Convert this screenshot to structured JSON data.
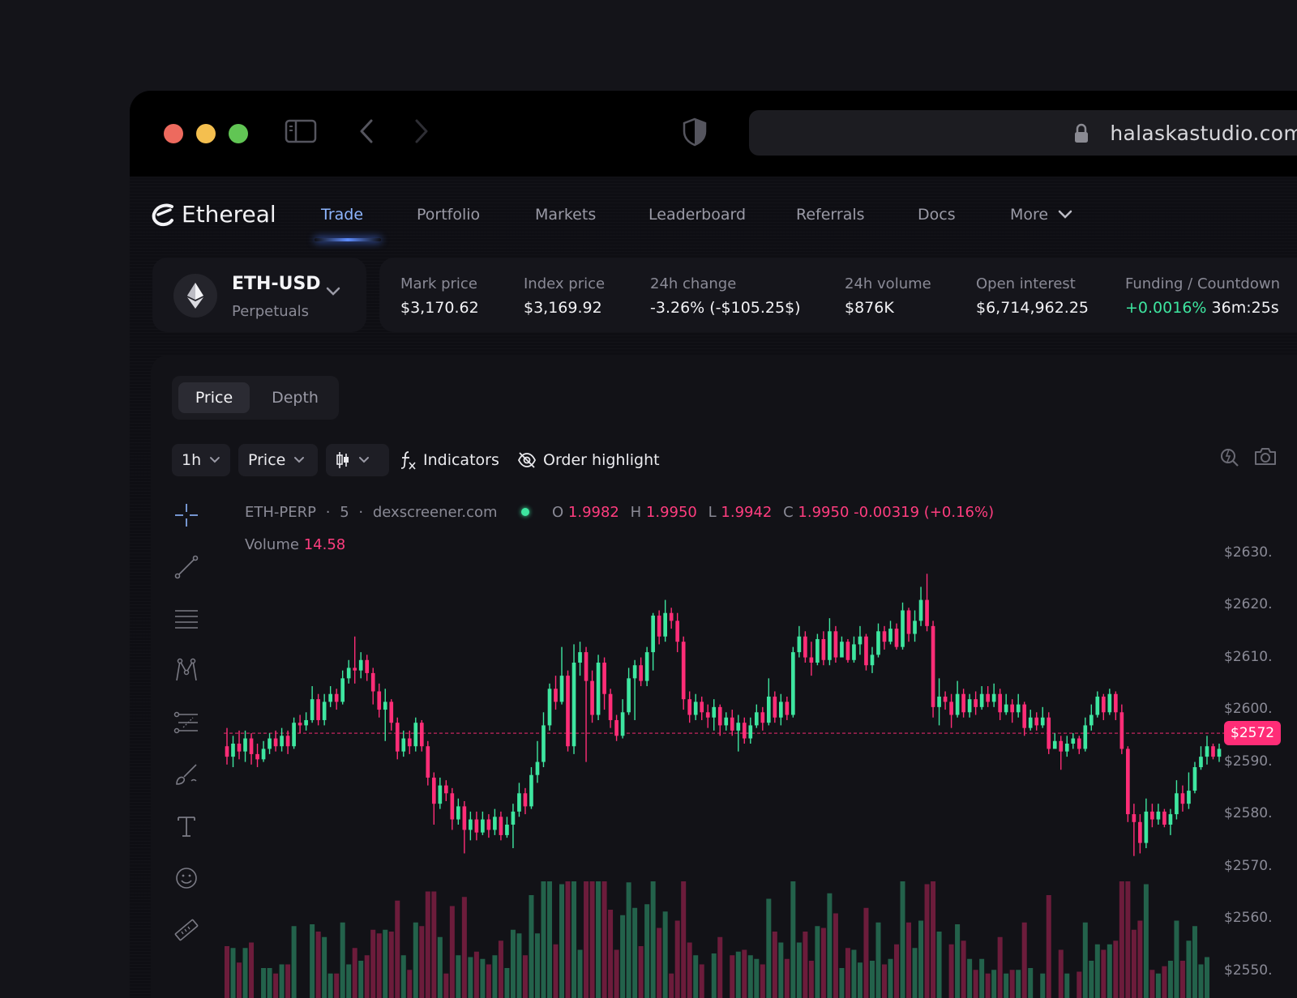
{
  "browser": {
    "url": "halaskastudio.com"
  },
  "app": {
    "logo_text": "Ethereal"
  },
  "nav": {
    "items": [
      {
        "label": "Trade",
        "active": true
      },
      {
        "label": "Portfolio"
      },
      {
        "label": "Markets"
      },
      {
        "label": "Leaderboard"
      },
      {
        "label": "Referrals"
      },
      {
        "label": "Docs"
      },
      {
        "label": "More"
      }
    ]
  },
  "pair": {
    "name": "ETH-USD",
    "type": "Perpetuals"
  },
  "stats": {
    "mark": {
      "label": "Mark price",
      "value": "$3,170.62"
    },
    "index": {
      "label": "Index price",
      "value": "$3,169.92"
    },
    "change": {
      "label": "24h change",
      "value": "-3.26% (-$105.25$)"
    },
    "volume": {
      "label": "24h volume",
      "value": "$876K"
    },
    "oi": {
      "label": "Open interest",
      "value": "$6,714,962.25"
    },
    "funding": {
      "label": "Funding / Countdown",
      "rate": "+0.0016%",
      "countdown": "36m:25s"
    }
  },
  "tabs": {
    "price": "Price",
    "depth": "Depth"
  },
  "toolbar": {
    "interval": "1h",
    "mode": "Price",
    "indicators": "Indicators",
    "order_highlight": "Order highlight"
  },
  "legend": {
    "symbol": "ETH-PERP",
    "interval": "5",
    "source": "dexscreener.com",
    "o_label": "O",
    "o": "1.9982",
    "h_label": "H",
    "h": "1.9950",
    "l_label": "L",
    "l": "1.9942",
    "c_label": "C",
    "c": "1.9950",
    "change": "-0.00319 (+0.16%)",
    "volume_label": "Volume",
    "volume": "14.58"
  },
  "colors": {
    "up": "#3ee6a0",
    "down": "#ff2d77",
    "accent": "#8eb6ff"
  },
  "chart_data": {
    "type": "candlestick",
    "y_ticks": [
      "$2630.",
      "$2620.",
      "$2610.",
      "$2600.",
      "$2572",
      "$2590.",
      "$2580.",
      "$2570.",
      "$2560.",
      "$2550."
    ],
    "y_tick_values": [
      2630,
      2620,
      2610,
      2600,
      2590,
      2580,
      2570,
      2560,
      2550
    ],
    "ylim": [
      2547,
      2640
    ],
    "current_price_label": "$2572",
    "current_price": 2595.5,
    "candles": [
      [
        2593.0,
        2591.0,
        2596.5,
        2589.5
      ],
      [
        2591.0,
        2593.5,
        2595.0,
        2589.0
      ],
      [
        2593.5,
        2592.0,
        2596.0,
        2590.5
      ],
      [
        2592.0,
        2594.5,
        2596.0,
        2590.0
      ],
      [
        2594.5,
        2591.5,
        2595.5,
        2589.5
      ],
      [
        2591.5,
        2590.5,
        2593.5,
        2589.0
      ],
      [
        2590.5,
        2592.5,
        2594.0,
        2590.0
      ],
      [
        2592.5,
        2594.5,
        2595.5,
        2591.5
      ],
      [
        2594.5,
        2593.0,
        2596.0,
        2592.0
      ],
      [
        2593.0,
        2595.0,
        2596.5,
        2592.0
      ],
      [
        2595.0,
        2593.0,
        2596.0,
        2591.5
      ],
      [
        2593.0,
        2597.5,
        2598.5,
        2592.5
      ],
      [
        2597.5,
        2597.0,
        2599.0,
        2595.5
      ],
      [
        2597.0,
        2598.0,
        2599.5,
        2596.0
      ],
      [
        2598.0,
        2602.0,
        2604.5,
        2597.5
      ],
      [
        2602.0,
        2598.0,
        2603.0,
        2597.0
      ],
      [
        2598.0,
        2601.5,
        2603.0,
        2597.0
      ],
      [
        2601.5,
        2603.0,
        2604.5,
        2600.5
      ],
      [
        2603.0,
        2601.5,
        2604.0,
        2600.0
      ],
      [
        2601.5,
        2606.0,
        2607.5,
        2601.0
      ],
      [
        2606.0,
        2608.0,
        2609.5,
        2605.0
      ],
      [
        2608.0,
        2607.5,
        2614.0,
        2605.0
      ],
      [
        2607.5,
        2609.5,
        2611.0,
        2606.0
      ],
      [
        2609.5,
        2607.0,
        2610.5,
        2605.5
      ],
      [
        2607.0,
        2603.5,
        2608.0,
        2601.0
      ],
      [
        2603.5,
        2600.0,
        2605.0,
        2598.5
      ],
      [
        2600.0,
        2601.5,
        2604.0,
        2594.0
      ],
      [
        2601.5,
        2597.5,
        2602.0,
        2596.0
      ],
      [
        2597.5,
        2592.0,
        2598.5,
        2590.5
      ],
      [
        2592.0,
        2594.5,
        2596.0,
        2591.0
      ],
      [
        2594.5,
        2593.0,
        2596.0,
        2591.5
      ],
      [
        2593.0,
        2597.5,
        2598.5,
        2592.0
      ],
      [
        2597.5,
        2593.0,
        2598.0,
        2592.0
      ],
      [
        2593.0,
        2587.0,
        2594.0,
        2585.5
      ],
      [
        2587.0,
        2582.0,
        2588.0,
        2578.0
      ],
      [
        2582.0,
        2585.5,
        2587.0,
        2581.0
      ],
      [
        2585.5,
        2584.0,
        2586.5,
        2582.5
      ],
      [
        2584.0,
        2579.0,
        2585.0,
        2577.0
      ],
      [
        2579.0,
        2581.5,
        2583.0,
        2578.0
      ],
      [
        2581.5,
        2577.0,
        2582.5,
        2572.5
      ],
      [
        2577.0,
        2579.0,
        2580.5,
        2575.0
      ],
      [
        2579.0,
        2576.5,
        2580.5,
        2575.0
      ],
      [
        2576.5,
        2579.0,
        2580.5,
        2576.0
      ],
      [
        2579.0,
        2577.0,
        2580.0,
        2575.5
      ],
      [
        2577.0,
        2579.5,
        2581.0,
        2576.0
      ],
      [
        2579.5,
        2576.0,
        2580.5,
        2575.0
      ],
      [
        2576.0,
        2578.0,
        2579.5,
        2575.5
      ],
      [
        2578.0,
        2580.5,
        2582.0,
        2573.5
      ],
      [
        2580.5,
        2584.0,
        2586.0,
        2579.5
      ],
      [
        2584.0,
        2581.5,
        2585.0,
        2580.0
      ],
      [
        2581.5,
        2587.5,
        2589.0,
        2581.0
      ],
      [
        2587.5,
        2590.0,
        2594.0,
        2586.0
      ],
      [
        2590.0,
        2597.0,
        2599.5,
        2589.0
      ],
      [
        2597.0,
        2604.0,
        2605.0,
        2596.0
      ],
      [
        2604.0,
        2601.5,
        2606.5,
        2600.0
      ],
      [
        2601.5,
        2606.5,
        2612.0,
        2601.0
      ],
      [
        2606.5,
        2593.0,
        2607.5,
        2592.0
      ],
      [
        2593.0,
        2609.0,
        2612.5,
        2591.5
      ],
      [
        2609.0,
        2611.0,
        2613.0,
        2606.5
      ],
      [
        2611.0,
        2605.5,
        2612.0,
        2590.0
      ],
      [
        2605.5,
        2599.0,
        2607.5,
        2597.5
      ],
      [
        2599.0,
        2609.0,
        2610.5,
        2598.0
      ],
      [
        2609.0,
        2603.0,
        2610.0,
        2600.0
      ],
      [
        2603.0,
        2598.0,
        2604.0,
        2596.5
      ],
      [
        2598.0,
        2595.0,
        2599.0,
        2594.0
      ],
      [
        2595.0,
        2599.5,
        2602.0,
        2594.5
      ],
      [
        2599.5,
        2606.0,
        2608.0,
        2599.0
      ],
      [
        2606.0,
        2608.5,
        2609.5,
        2598.0
      ],
      [
        2608.5,
        2605.5,
        2610.0,
        2604.5
      ],
      [
        2605.5,
        2611.0,
        2612.0,
        2604.5
      ],
      [
        2611.0,
        2618.0,
        2618.5,
        2607.5
      ],
      [
        2618.0,
        2614.0,
        2619.0,
        2612.5
      ],
      [
        2614.0,
        2618.5,
        2621.0,
        2613.0
      ],
      [
        2618.5,
        2617.0,
        2619.5,
        2615.5
      ],
      [
        2617.0,
        2613.0,
        2618.5,
        2611.0
      ],
      [
        2613.0,
        2602.0,
        2614.0,
        2600.0
      ],
      [
        2602.0,
        2599.0,
        2603.5,
        2597.5
      ],
      [
        2599.0,
        2601.5,
        2603.0,
        2598.0
      ],
      [
        2601.5,
        2599.5,
        2602.5,
        2598.0
      ],
      [
        2599.5,
        2598.5,
        2601.0,
        2596.5
      ],
      [
        2598.5,
        2600.5,
        2602.0,
        2596.0
      ],
      [
        2600.5,
        2597.0,
        2601.0,
        2595.0
      ],
      [
        2597.0,
        2598.5,
        2599.5,
        2596.0
      ],
      [
        2598.5,
        2596.0,
        2600.0,
        2595.0
      ],
      [
        2596.0,
        2597.5,
        2599.0,
        2592.0
      ],
      [
        2597.5,
        2594.5,
        2598.5,
        2593.5
      ],
      [
        2594.5,
        2597.0,
        2598.5,
        2593.5
      ],
      [
        2597.0,
        2599.5,
        2601.0,
        2596.5
      ],
      [
        2599.5,
        2597.5,
        2600.5,
        2596.0
      ],
      [
        2597.5,
        2602.5,
        2606.0,
        2597.0
      ],
      [
        2602.5,
        2598.5,
        2603.5,
        2597.5
      ],
      [
        2598.5,
        2601.5,
        2603.0,
        2597.0
      ],
      [
        2601.5,
        2599.0,
        2602.5,
        2598.0
      ],
      [
        2599.0,
        2611.0,
        2612.0,
        2598.5
      ],
      [
        2611.0,
        2614.0,
        2616.0,
        2610.0
      ],
      [
        2614.0,
        2610.0,
        2615.0,
        2609.0
      ],
      [
        2610.0,
        2609.0,
        2613.0,
        2606.5
      ],
      [
        2609.0,
        2613.5,
        2614.5,
        2608.5
      ],
      [
        2613.5,
        2609.5,
        2615.0,
        2608.5
      ],
      [
        2609.5,
        2615.0,
        2617.5,
        2608.5
      ],
      [
        2615.0,
        2610.0,
        2616.0,
        2609.0
      ],
      [
        2610.0,
        2613.0,
        2614.0,
        2611.5
      ],
      [
        2613.0,
        2609.5,
        2613.5,
        2609.0
      ],
      [
        2609.5,
        2612.5,
        2614.0,
        2609.0
      ],
      [
        2612.5,
        2614.0,
        2616.0,
        2610.5
      ],
      [
        2614.0,
        2608.5,
        2614.5,
        2607.5
      ],
      [
        2608.5,
        2610.5,
        2612.0,
        2607.0
      ],
      [
        2610.5,
        2615.0,
        2616.5,
        2610.0
      ],
      [
        2615.0,
        2613.0,
        2616.0,
        2611.5
      ],
      [
        2613.0,
        2615.5,
        2617.0,
        2612.5
      ],
      [
        2615.5,
        2612.0,
        2616.5,
        2611.5
      ],
      [
        2612.0,
        2619.0,
        2620.5,
        2611.5
      ],
      [
        2619.0,
        2614.5,
        2619.5,
        2613.0
      ],
      [
        2614.5,
        2617.0,
        2619.0,
        2613.0
      ],
      [
        2617.0,
        2621.0,
        2623.5,
        2616.0
      ],
      [
        2621.0,
        2616.0,
        2626.0,
        2615.0
      ],
      [
        2616.0,
        2600.5,
        2617.0,
        2598.5
      ],
      [
        2600.5,
        2602.5,
        2606.0,
        2597.0
      ],
      [
        2602.5,
        2601.5,
        2603.5,
        2600.0
      ],
      [
        2601.5,
        2599.0,
        2603.0,
        2596.5
      ],
      [
        2599.0,
        2603.0,
        2605.5,
        2598.5
      ],
      [
        2603.0,
        2599.5,
        2604.0,
        2598.5
      ],
      [
        2599.5,
        2602.0,
        2603.0,
        2598.5
      ],
      [
        2602.0,
        2600.5,
        2603.5,
        2599.0
      ],
      [
        2600.5,
        2603.0,
        2604.5,
        2600.0
      ],
      [
        2603.0,
        2601.5,
        2604.5,
        2600.5
      ],
      [
        2601.5,
        2603.0,
        2605.0,
        2600.5
      ],
      [
        2603.0,
        2599.5,
        2604.0,
        2598.0
      ],
      [
        2599.5,
        2601.0,
        2603.0,
        2599.0
      ],
      [
        2601.0,
        2599.5,
        2602.0,
        2597.5
      ],
      [
        2599.5,
        2601.0,
        2603.0,
        2598.5
      ],
      [
        2601.0,
        2596.5,
        2601.5,
        2595.0
      ],
      [
        2596.5,
        2598.5,
        2600.0,
        2596.0
      ],
      [
        2598.5,
        2597.0,
        2599.5,
        2596.0
      ],
      [
        2597.0,
        2598.5,
        2600.5,
        2596.5
      ],
      [
        2598.5,
        2592.5,
        2599.5,
        2591.5
      ],
      [
        2592.5,
        2594.0,
        2595.5,
        2593.0
      ],
      [
        2594.0,
        2592.0,
        2595.0,
        2588.5
      ],
      [
        2592.0,
        2593.5,
        2595.0,
        2591.0
      ],
      [
        2593.5,
        2594.5,
        2595.5,
        2592.5
      ],
      [
        2594.5,
        2592.5,
        2595.0,
        2591.5
      ],
      [
        2592.5,
        2597.0,
        2598.5,
        2592.0
      ],
      [
        2597.0,
        2599.0,
        2601.0,
        2596.0
      ],
      [
        2599.0,
        2602.5,
        2603.5,
        2598.5
      ],
      [
        2602.5,
        2599.5,
        2603.0,
        2598.0
      ],
      [
        2599.5,
        2603.0,
        2604.0,
        2599.0
      ],
      [
        2603.0,
        2599.5,
        2603.5,
        2598.0
      ],
      [
        2599.5,
        2592.5,
        2601.0,
        2591.5
      ],
      [
        2592.5,
        2580.0,
        2593.0,
        2578.5
      ],
      [
        2580.0,
        2578.5,
        2582.0,
        2572.0
      ],
      [
        2578.5,
        2574.5,
        2580.0,
        2572.5
      ],
      [
        2574.5,
        2580.5,
        2583.0,
        2573.5
      ],
      [
        2580.5,
        2579.0,
        2582.0,
        2577.5
      ],
      [
        2579.0,
        2580.5,
        2582.0,
        2578.0
      ],
      [
        2580.5,
        2578.0,
        2581.0,
        2577.5
      ],
      [
        2578.0,
        2580.0,
        2581.0,
        2576.0
      ],
      [
        2580.0,
        2584.0,
        2586.5,
        2579.0
      ],
      [
        2584.0,
        2582.0,
        2585.5,
        2580.5
      ],
      [
        2582.0,
        2584.5,
        2588.0,
        2581.0
      ],
      [
        2584.5,
        2589.0,
        2590.0,
        2584.0
      ],
      [
        2589.0,
        2591.0,
        2593.0,
        2588.5
      ],
      [
        2591.0,
        2593.0,
        2595.0,
        2589.5
      ],
      [
        2593.0,
        2591.0,
        2593.5,
        2590.5
      ],
      [
        2591.0,
        2592.5,
        2593.5,
        2590.0
      ]
    ]
  }
}
